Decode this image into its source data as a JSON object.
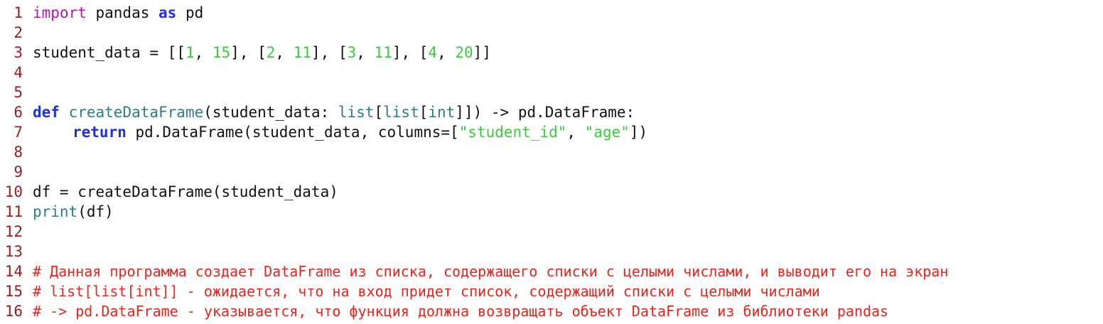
{
  "line_numbers": [
    "1",
    "2",
    "3",
    "4",
    "5",
    "6",
    "7",
    "8",
    "9",
    "10",
    "11",
    "12",
    "13",
    "14",
    "15",
    "16"
  ],
  "line1": {
    "kw_import": "import",
    "t1": " pandas ",
    "kw_as": "as",
    "t2": " pd"
  },
  "line3": {
    "t1": "student_data = [[",
    "n1": "1",
    "c1": ", ",
    "n2": "15",
    "c2": "], [",
    "n3": "2",
    "c3": ", ",
    "n4": "11",
    "c4": "], [",
    "n5": "3",
    "c5": ", ",
    "n6": "11",
    "c6": "], [",
    "n7": "4",
    "c7": ", ",
    "n8": "20",
    "c8": "]]"
  },
  "line6": {
    "kw_def": "def",
    "sp": " ",
    "fn_name": "createDataFrame",
    "t1": "(student_data: ",
    "list1": "list",
    "b1": "[",
    "list2": "list",
    "b2": "[",
    "int": "int",
    "t2": "]]) -> pd.DataFrame:"
  },
  "line7": {
    "kw_return": "return",
    "t1": " pd.DataFrame(student_data, columns=[",
    "s1": "\"student_id\"",
    "t2": ", ",
    "s2": "\"age\"",
    "t3": "])"
  },
  "line10": {
    "t1": "df = createDataFrame(student_data)"
  },
  "line11": {
    "fn_print": "print",
    "t1": "(df)"
  },
  "line14": {
    "comment": "# Данная программа создает DataFrame из списка, содержащего списки с целыми числами, и выводит его на экран"
  },
  "line15": {
    "comment": "# list[list[int]] - ожидается, что на вход придет список, содержащий списки с целыми числами"
  },
  "line16": {
    "comment": "# -> pd.DataFrame - указывается, что функция должна возвращать объект DataFrame из библиотеки pandas"
  }
}
